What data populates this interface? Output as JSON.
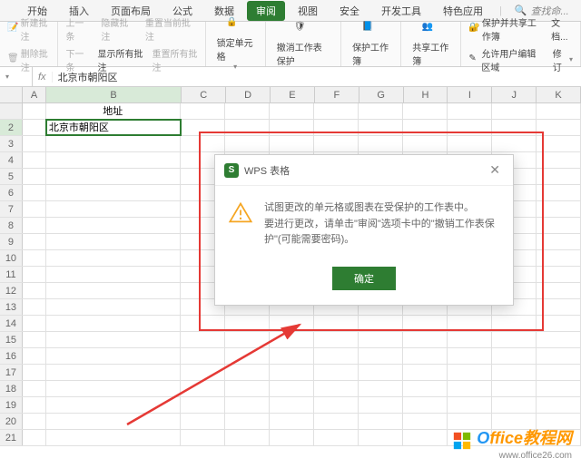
{
  "tabs": {
    "items": [
      "开始",
      "插入",
      "页面布局",
      "公式",
      "数据",
      "审阅",
      "视图",
      "安全",
      "开发工具",
      "特色应用"
    ],
    "active_index": 5,
    "search_placeholder": "查找命..."
  },
  "ribbon": {
    "grp1": {
      "new_comment": "新建批注",
      "delete_comment": "删除批注"
    },
    "grp2": {
      "prev": "上一条",
      "next": "下一条",
      "hide": "隐藏批注",
      "show_all": "显示所有批注",
      "reset": "重置当前批注",
      "reset_all": "重置所有批注"
    },
    "grp3": {
      "lock_cell": "锁定单元格",
      "unprotect": "撤消工作表保护",
      "protect_wb": "保护工作簿",
      "share_wb": "共享工作簿"
    },
    "grp4": {
      "protect_share": "保护并共享工作簿",
      "allow_edit": "允许用户编辑区域",
      "track": "文档..."
    },
    "grp5": {
      "revise": "修订"
    }
  },
  "formula_bar": {
    "name_box": "",
    "fx": "fx",
    "value": "北京市朝阳区"
  },
  "grid": {
    "columns": [
      "A",
      "B",
      "C",
      "D",
      "E",
      "F",
      "G",
      "H",
      "I",
      "J",
      "K"
    ],
    "active_col": "B",
    "active_row": 2,
    "header_row": 1,
    "address_header": "地址",
    "active_cell_value": "北京市朝阳区",
    "rows": 21
  },
  "dialog": {
    "title": "WPS 表格",
    "line1": "试图更改的单元格或图表在受保护的工作表中。",
    "line2": "要进行更改，请单击\"审阅\"选项卡中的\"撤销工作表保护\"(可能需要密码)。",
    "ok": "确定"
  },
  "watermark": {
    "brand": "Office教程网",
    "url": "www.office26.com"
  }
}
